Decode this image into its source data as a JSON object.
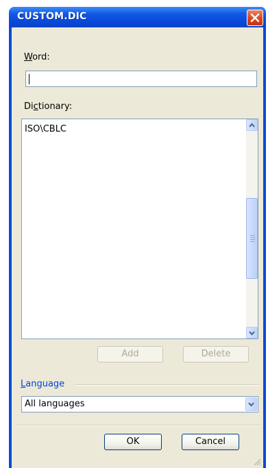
{
  "window": {
    "title": "CUSTOM.DIC"
  },
  "word": {
    "label_accel": "W",
    "label_rest": "ord:",
    "value": ""
  },
  "dictionary": {
    "label_pre": "Di",
    "label_accel": "c",
    "label_rest": "tionary:",
    "items": [
      "ISO\\CBLC"
    ]
  },
  "buttons": {
    "add": "Add",
    "delete": "Delete",
    "ok": "OK",
    "cancel": "Cancel"
  },
  "language": {
    "label_accel": "L",
    "label_rest": "anguage",
    "selected": "All languages"
  },
  "colors": {
    "titlebar": "#0a4ad8",
    "client": "#ece9d8",
    "link_blue": "#0046d5",
    "close": "#d9421a"
  },
  "icons": {
    "close": "close-icon",
    "scroll_up": "arrow-up-icon",
    "scroll_down": "arrow-down-icon",
    "combo": "chevron-down-icon"
  }
}
